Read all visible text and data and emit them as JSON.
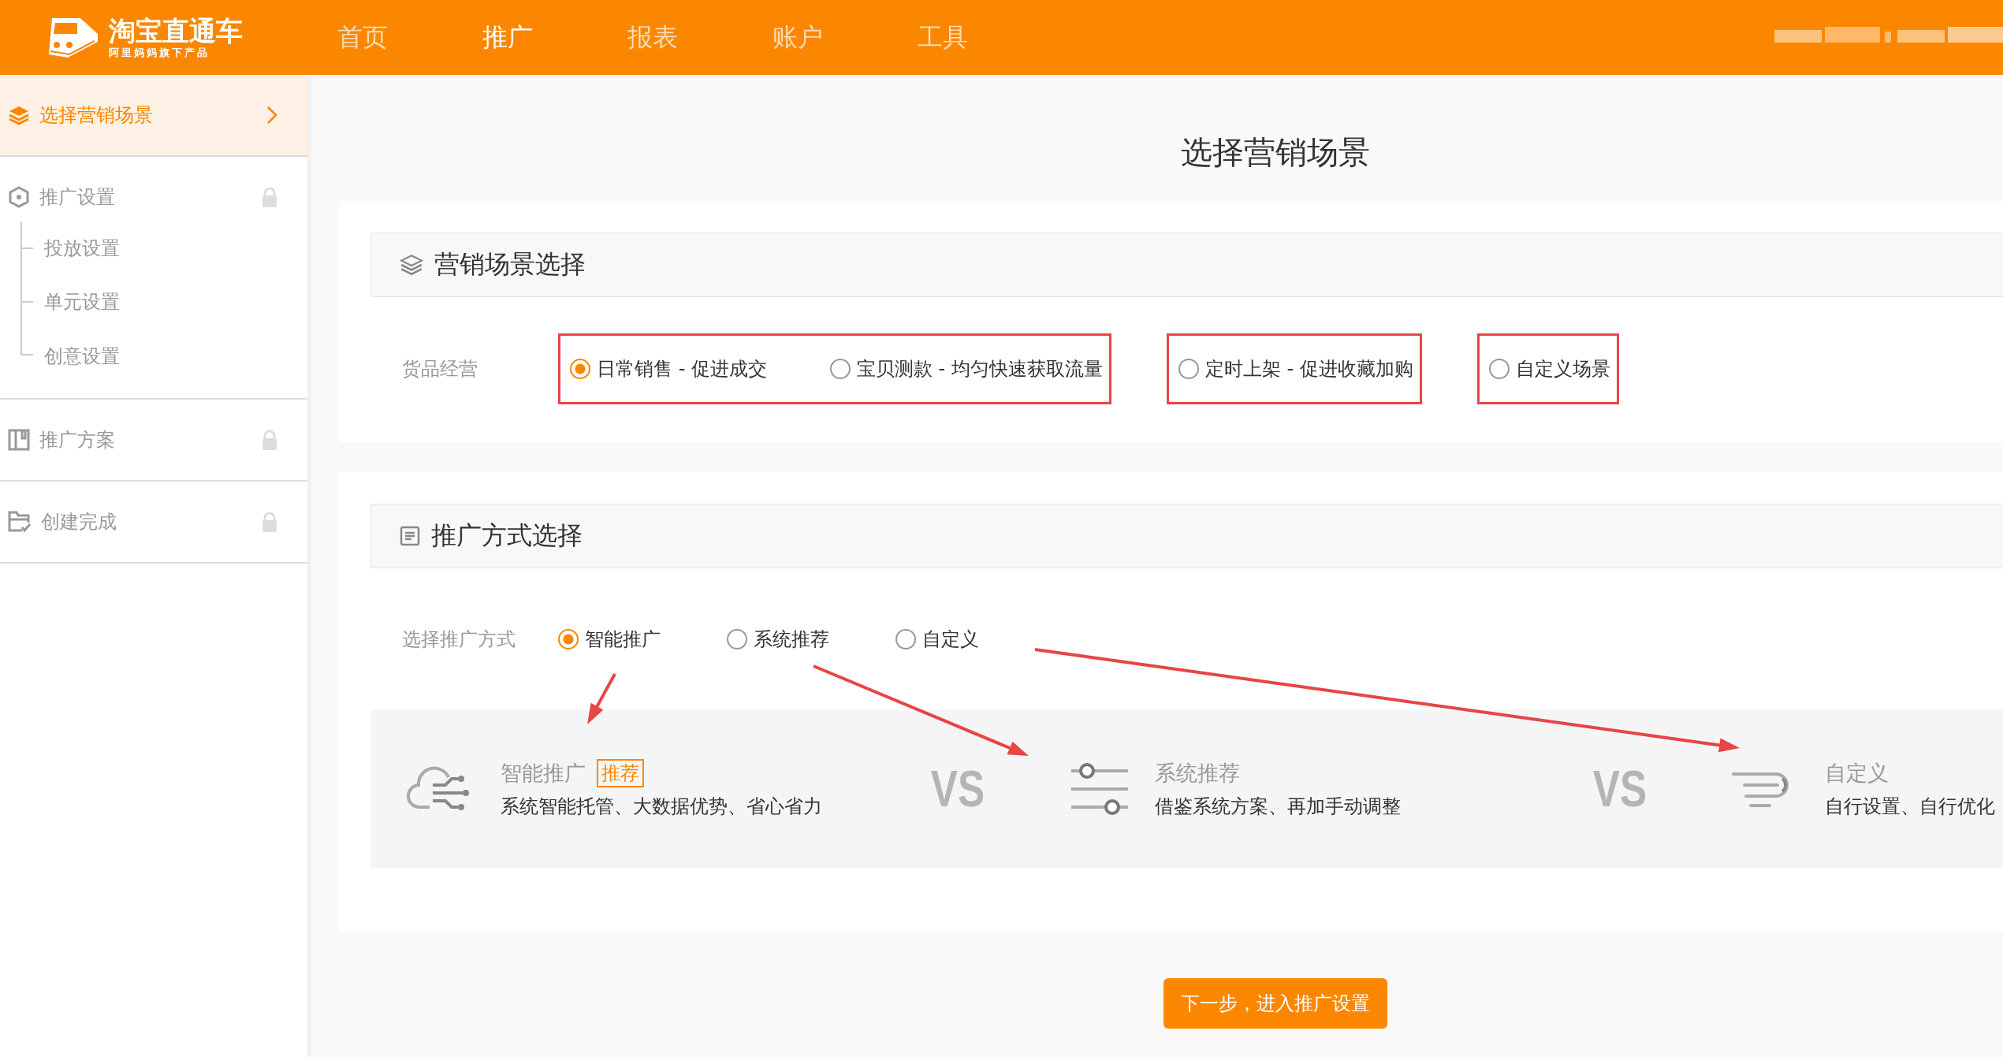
{
  "header": {
    "logo": {
      "title": "淘宝直通车",
      "subtitle": "阿里妈妈旗下产品"
    },
    "nav": [
      {
        "label": "首页",
        "selected": false
      },
      {
        "label": "推广",
        "selected": true
      },
      {
        "label": "报表",
        "selected": false
      },
      {
        "label": "账户",
        "selected": false
      },
      {
        "label": "工具",
        "selected": false
      }
    ]
  },
  "sidebar": {
    "items": [
      {
        "kind": "layers",
        "label": "选择营销场景",
        "selected": true,
        "locked": false
      },
      {
        "kind": "hexagon",
        "label": "推广设置",
        "selected": false,
        "locked": true,
        "children": [
          {
            "label": "投放设置"
          },
          {
            "label": "单元设置"
          },
          {
            "label": "创意设置"
          }
        ]
      },
      {
        "kind": "board",
        "label": "推广方案",
        "selected": false,
        "locked": true
      },
      {
        "kind": "folder",
        "label": "创建完成",
        "selected": false,
        "locked": true
      }
    ]
  },
  "page_title": "选择营销场景",
  "scene_section": {
    "title": "营销场景选择",
    "row_label": "货品经营",
    "groups": [
      {
        "highlighted": true,
        "options": [
          {
            "label": "日常销售 - 促进成交",
            "selected": true
          },
          {
            "label": "宝贝测款 - 均匀快速获取流量",
            "selected": false
          }
        ]
      },
      {
        "highlighted": true,
        "options": [
          {
            "label": "定时上架 - 促进收藏加购",
            "selected": false
          }
        ]
      },
      {
        "highlighted": true,
        "options": [
          {
            "label": "自定义场景",
            "selected": false
          }
        ]
      }
    ]
  },
  "method_section": {
    "title": "推广方式选择",
    "row_label": "选择推广方式",
    "options": [
      {
        "label": "智能推广",
        "selected": true
      },
      {
        "label": "系统推荐",
        "selected": false
      },
      {
        "label": "自定义",
        "selected": false
      }
    ],
    "comparison": [
      {
        "kind": "smart",
        "title": "智能推广",
        "badge": "推荐",
        "description": "系统智能托管、大数据优势、省心省力"
      },
      {
        "kind": "vs",
        "text": "VS"
      },
      {
        "kind": "system",
        "title": "系统推荐",
        "description": "借鉴系统方案、再加手动调整"
      },
      {
        "kind": "vs",
        "text": "VS"
      },
      {
        "kind": "custom",
        "title": "自定义",
        "description": "自行设置、自行优化"
      }
    ]
  },
  "next_button": "下一步，进入推广设置"
}
